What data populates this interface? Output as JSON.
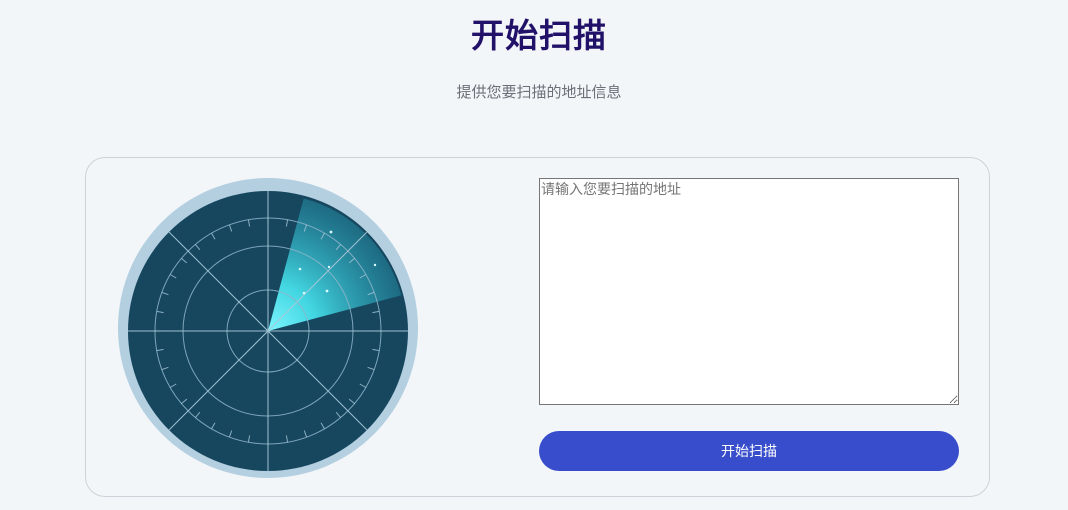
{
  "header": {
    "title": "开始扫描",
    "subtitle": "提供您要扫描的地址信息"
  },
  "scan_form": {
    "address_value": "",
    "address_placeholder": "请输入您要扫描的地址",
    "submit_label": "开始扫描"
  },
  "radar": {
    "icon": "radar-icon",
    "colors": {
      "outer_ring": "#b3cfe0",
      "face": "#16475f",
      "grid": "#9fc1d4",
      "sweep": "#47e6f0"
    }
  }
}
